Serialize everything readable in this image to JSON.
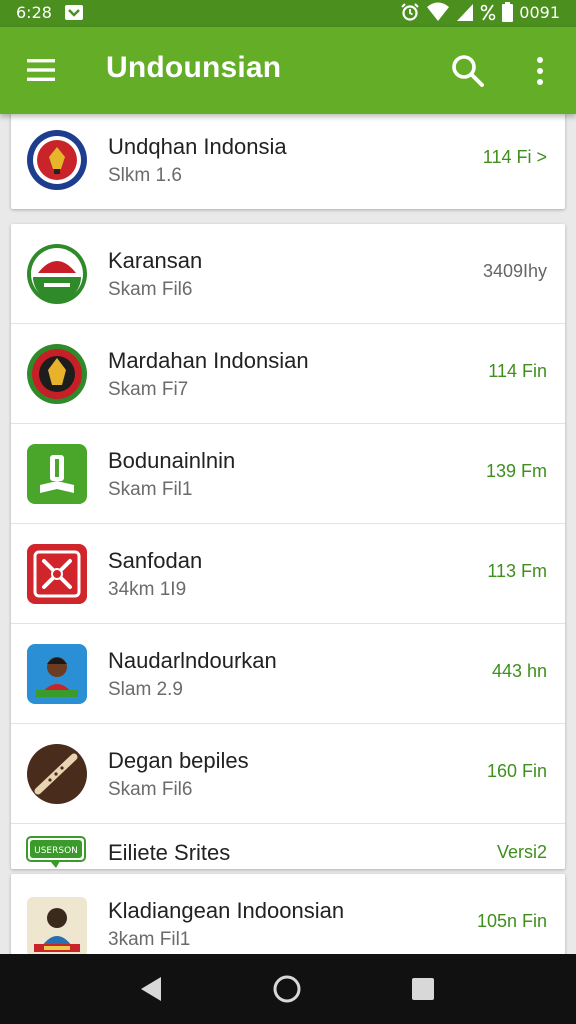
{
  "status_bar": {
    "time": "6:28",
    "battery": "0091"
  },
  "app_bar": {
    "title": "Undounsian"
  },
  "icons": {
    "menu": "hamburger-menu-icon",
    "search": "search-icon",
    "more": "more-vert-icon",
    "back": "back-triangle-icon",
    "home": "home-circle-icon",
    "recents": "recents-square-icon"
  },
  "colors": {
    "status_bar": "#4b8f1f",
    "app_bar": "#63ad27",
    "accent_text": "#3f8f1d"
  },
  "items": [
    {
      "name": "Undqhan Indonsia",
      "sub": "Slkm 1.6",
      "meta": "114 Fi",
      "chevron": ">"
    },
    {
      "name": "Karansan",
      "sub": "Skam Fil6",
      "meta": "3409Ihy"
    },
    {
      "name": "Mardahan Indonsian",
      "sub": "Skam Fi7",
      "meta": "114 Fin"
    },
    {
      "name": "Bodunainlnin",
      "sub": "Skam Fil1",
      "meta": "139 Fm"
    },
    {
      "name": "Sanfodan",
      "sub": "34km 1I9",
      "meta": "113 Fm"
    },
    {
      "name": "Naudarlndourkan",
      "sub": "Slam 2.9",
      "meta": "443 hn"
    },
    {
      "name": "Degan bepiles",
      "sub": "Skam Fil6",
      "meta": "160 Fin"
    },
    {
      "name": "Eiliete Srites",
      "meta": "Versi2",
      "badge": "USERSON"
    },
    {
      "name": "Kladiangean Indoonsian",
      "sub": "3kam Fil1",
      "meta": "105n Fin"
    }
  ]
}
